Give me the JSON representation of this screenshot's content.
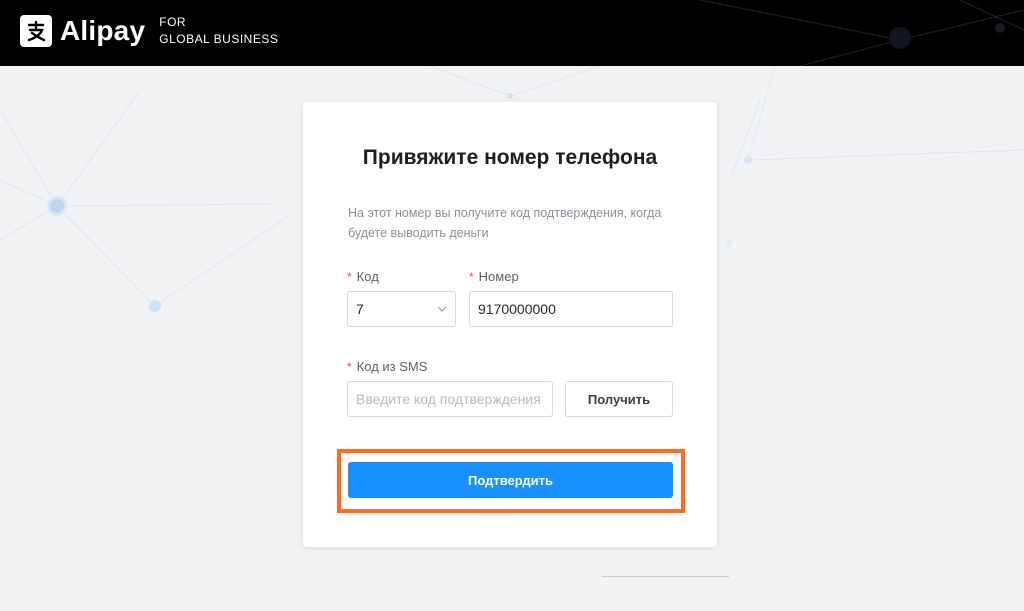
{
  "header": {
    "brand": "Alipay",
    "brand_sub_line1": "FOR",
    "brand_sub_line2": "GLOBAL BUSINESS"
  },
  "card": {
    "title": "Привяжите номер телефона",
    "description": "На этот номер вы получите код подтверждения, когда будете выводить деньги"
  },
  "form": {
    "code_label": "Код",
    "code_value": "7",
    "number_label": "Номер",
    "number_value": "9170000000",
    "sms_label": "Код из SMS",
    "sms_placeholder": "Введите код подтверждения",
    "get_button": "Получить",
    "required_mark": "*"
  },
  "actions": {
    "confirm_button": "Подтвердить"
  },
  "colors": {
    "accent": "#1890ff",
    "highlight": "#ff6a1f",
    "required": "#f5453a",
    "header_bg": "#000000",
    "page_bg": "#f1f2f4"
  }
}
